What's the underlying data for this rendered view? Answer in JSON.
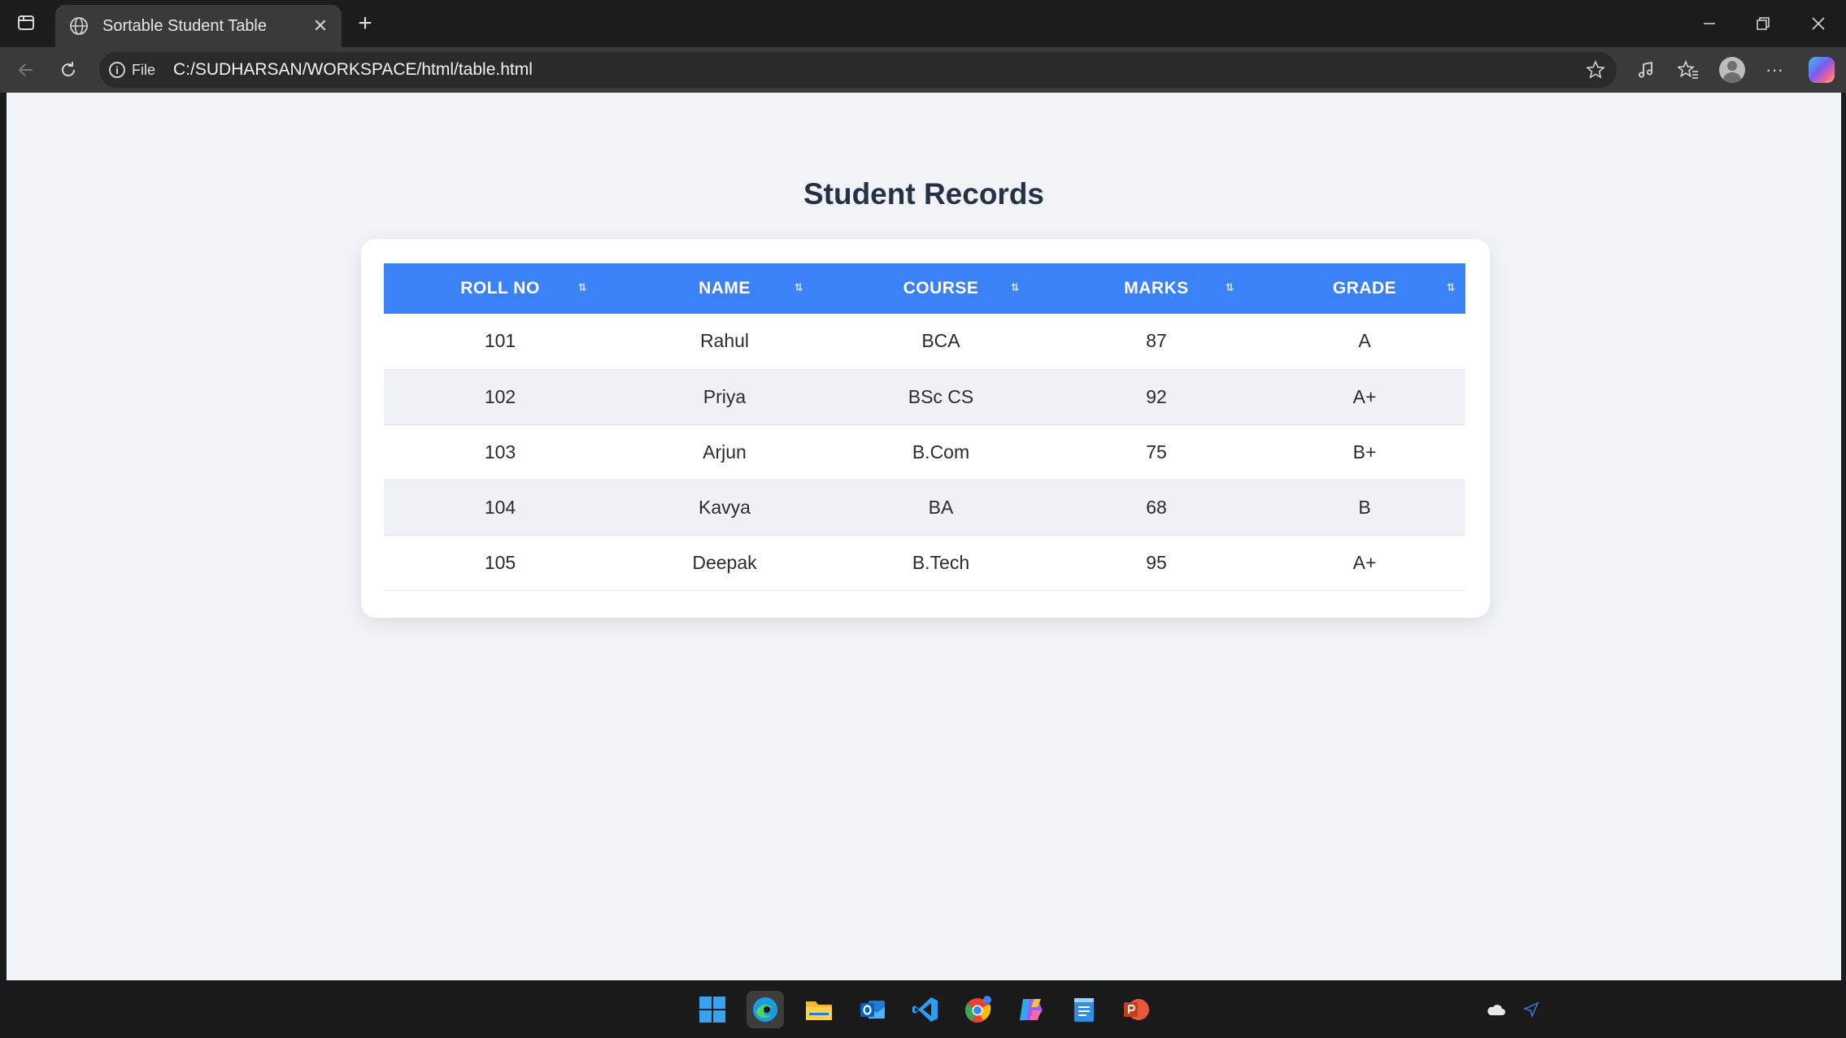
{
  "browser": {
    "tab_title": "Sortable Student Table",
    "site_info_label": "File",
    "url": "C:/SUDHARSAN/WORKSPACE/html/table.html"
  },
  "page": {
    "title": "Student Records",
    "table": {
      "columns": [
        "ROLL NO",
        "NAME",
        "COURSE",
        "MARKS",
        "GRADE"
      ],
      "sort_icon": "⇅",
      "rows": [
        [
          "101",
          "Rahul",
          "BCA",
          "87",
          "A"
        ],
        [
          "102",
          "Priya",
          "BSc CS",
          "92",
          "A+"
        ],
        [
          "103",
          "Arjun",
          "B.Com",
          "75",
          "B+"
        ],
        [
          "104",
          "Kavya",
          "BA",
          "68",
          "B"
        ],
        [
          "105",
          "Deepak",
          "B.Tech",
          "95",
          "A+"
        ]
      ]
    }
  },
  "colors": {
    "header_bg": "#3b82f6",
    "title_text": "#233245",
    "page_bg": "#f1f3f6",
    "alt_row_bg": "#eff1f6"
  },
  "taskbar": {
    "apps": [
      "windows-start-icon",
      "edge-icon",
      "file-explorer-icon",
      "outlook-icon",
      "vscode-icon",
      "chrome-icon",
      "copilot-app-icon",
      "notepad-icon",
      "powerpoint-icon"
    ]
  }
}
